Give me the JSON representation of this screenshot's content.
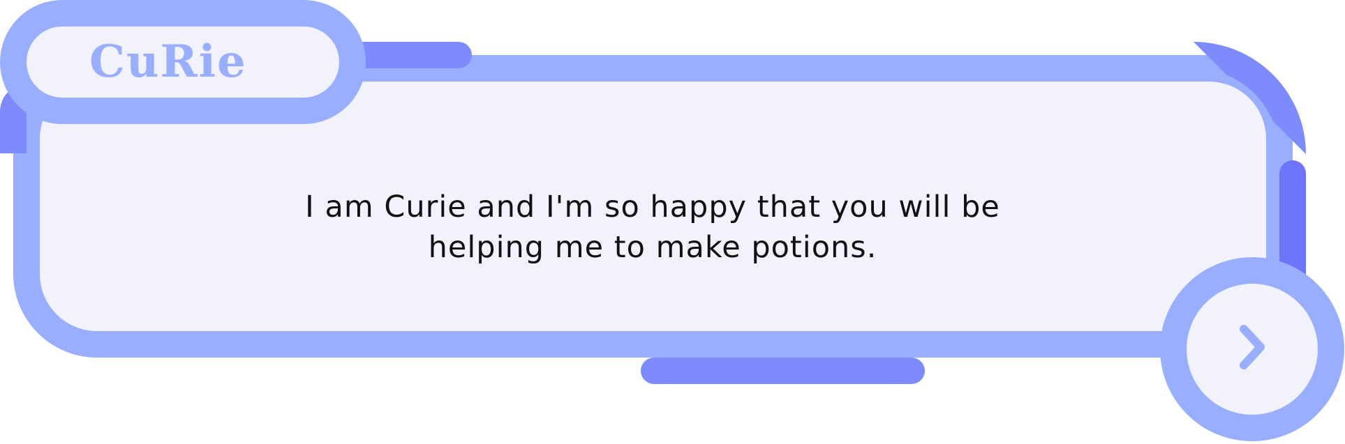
{
  "dialog": {
    "speaker_name": "CuRie",
    "message": "I am Curie and I'm so happy that you will be helping me to make potions."
  },
  "next_button": {
    "icon": "chevron-right-icon"
  },
  "colors": {
    "panel_border": "#99aefe",
    "panel_fill": "#f1f2fc",
    "accent": "#7d8bfd",
    "accent_dark": "#6f75fa",
    "text": "#111111"
  }
}
